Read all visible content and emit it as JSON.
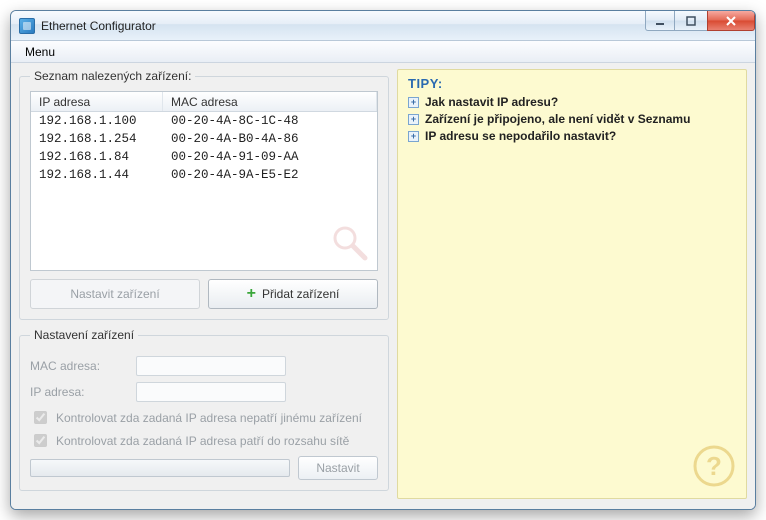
{
  "window": {
    "title": "Ethernet Configurator"
  },
  "menubar": {
    "menu": "Menu"
  },
  "panel": {
    "list_title": "Seznam nalezených zařízení:",
    "columns": {
      "ip": "IP adresa",
      "mac": "MAC adresa"
    },
    "rows": [
      {
        "ip": "192.168.1.100",
        "mac": "00-20-4A-8C-1C-48"
      },
      {
        "ip": "192.168.1.254",
        "mac": "00-20-4A-B0-4A-86"
      },
      {
        "ip": "192.168.1.84",
        "mac": "00-20-4A-91-09-AA"
      },
      {
        "ip": "192.168.1.44",
        "mac": "00-20-4A-9A-E5-E2"
      }
    ],
    "btn_configure": "Nastavit zařízení",
    "btn_add": "Přidat zařízení"
  },
  "settings": {
    "title": "Nastavení zařízení",
    "mac_label": "MAC adresa:",
    "ip_label": "IP adresa:",
    "mac_value": "",
    "ip_value": "",
    "check_conflict": "Kontrolovat zda zadaná IP adresa nepatří jinému zařízení",
    "check_range": "Kontrolovat zda zadaná IP adresa patří do rozsahu sítě",
    "btn_apply": "Nastavit"
  },
  "tips": {
    "title": "TIPY:",
    "items": [
      "Jak nastavit IP adresu?",
      "Zařízení je připojeno, ale není vidět v Seznamu",
      "IP adresu se nepodařilo nastavit?"
    ]
  }
}
